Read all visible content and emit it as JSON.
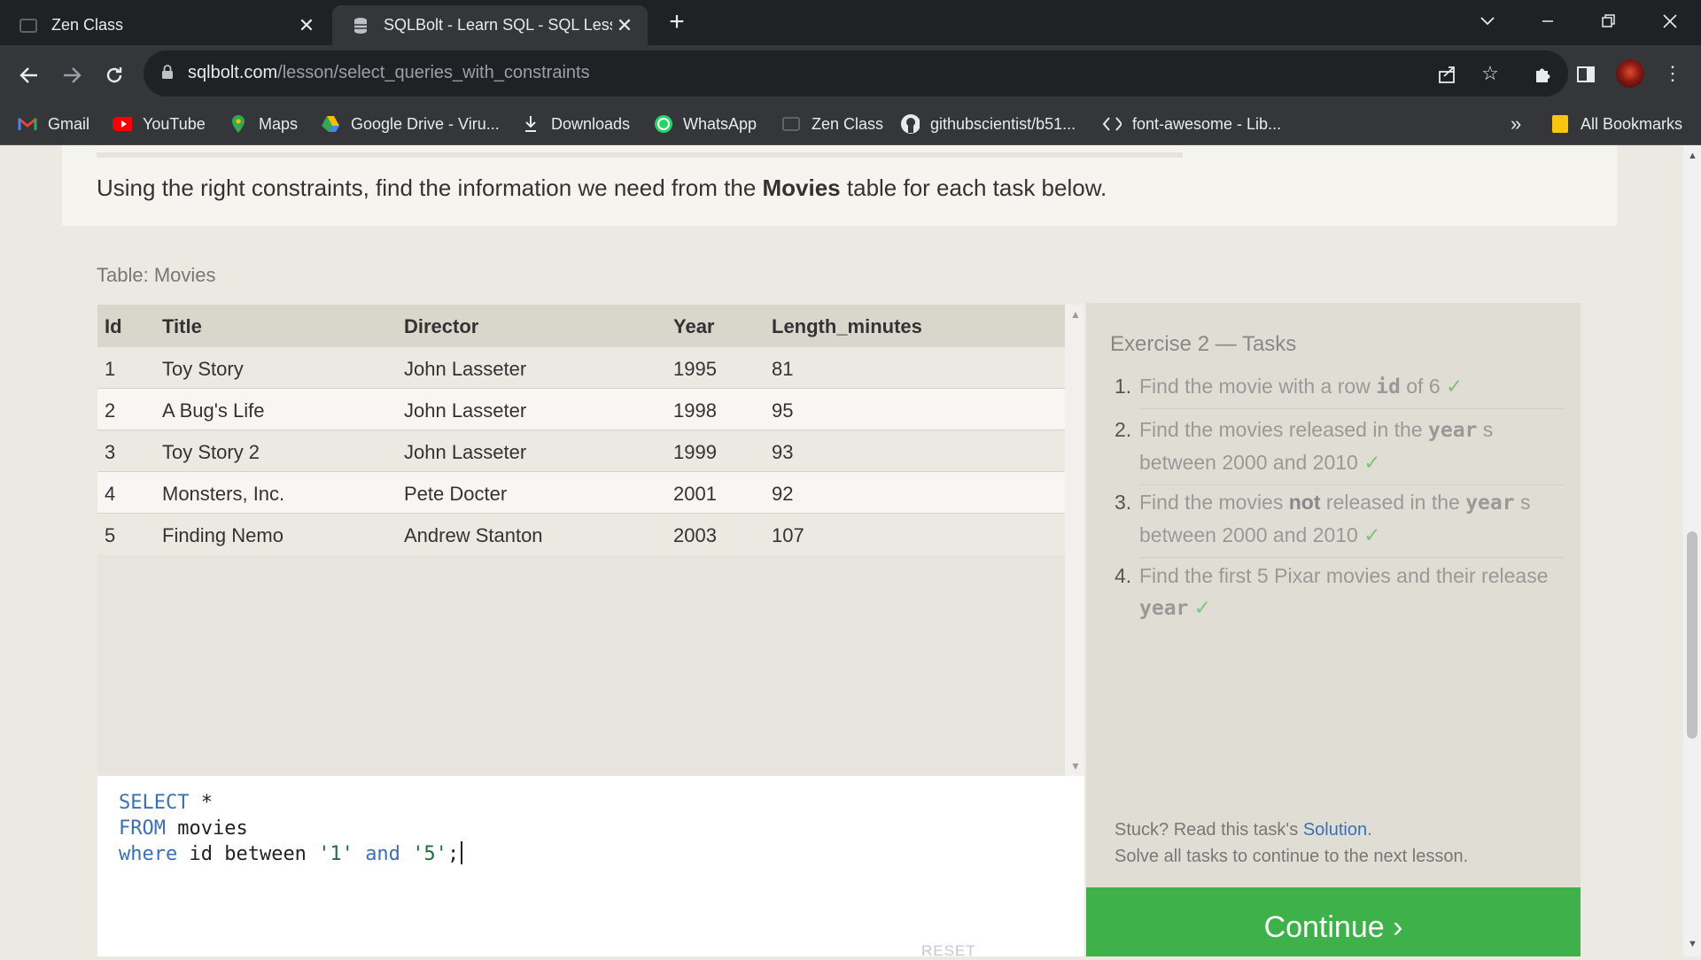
{
  "browser": {
    "tabs": [
      {
        "title": "Zen Class",
        "active": false
      },
      {
        "title": "SQLBolt - Learn SQL - SQL Lesso",
        "active": true
      }
    ],
    "new_tab_glyph": "+",
    "close_glyph": "✕",
    "url_host": "sqlbolt.com",
    "url_path": "/lesson/select_queries_with_constraints",
    "bookmarks": [
      {
        "label": "Gmail",
        "icon": "gmail-icon"
      },
      {
        "label": "YouTube",
        "icon": "youtube-icon"
      },
      {
        "label": "Maps",
        "icon": "maps-icon"
      },
      {
        "label": "Google Drive - Viru...",
        "icon": "google-drive-icon"
      },
      {
        "label": "Downloads",
        "icon": "download-icon"
      },
      {
        "label": "WhatsApp",
        "icon": "whatsapp-icon"
      },
      {
        "label": "Zen Class",
        "icon": "zen-class-icon"
      },
      {
        "label": "githubscientist/b51...",
        "icon": "github-icon"
      },
      {
        "label": "font-awesome - Lib...",
        "icon": "code-icon"
      }
    ],
    "bookmarks_overflow": "»",
    "all_bookmarks": "All Bookmarks"
  },
  "lesson": {
    "intro_before": "Using the right constraints, find the information we need from the ",
    "intro_bold": "Movies",
    "intro_after": " table for each task below.",
    "table_label": "Table: Movies",
    "columns": [
      "Id",
      "Title",
      "Director",
      "Year",
      "Length_minutes"
    ],
    "rows": [
      [
        "1",
        "Toy Story",
        "John Lasseter",
        "1995",
        "81"
      ],
      [
        "2",
        "A Bug's Life",
        "John Lasseter",
        "1998",
        "95"
      ],
      [
        "3",
        "Toy Story 2",
        "John Lasseter",
        "1999",
        "93"
      ],
      [
        "4",
        "Monsters, Inc.",
        "Pete Docter",
        "2001",
        "92"
      ],
      [
        "5",
        "Finding Nemo",
        "Andrew Stanton",
        "2003",
        "107"
      ]
    ],
    "code": {
      "line1_kw": "SELECT",
      "line1_rest": " *",
      "line2_kw": "FROM",
      "line2_rest": " movies",
      "line3_kw": "where",
      "line3_a": " id between ",
      "line3_s1": "'1'",
      "line3_and": "and",
      "line3_s2": "'5'",
      "line3_end": ";"
    },
    "reset_label": "RESET"
  },
  "tasks": {
    "title": "Exercise 2 — Tasks",
    "items": [
      {
        "num": "1.",
        "a": "Find the movie with a row ",
        "mono": "id",
        "b": " of 6 ",
        "check": "✓"
      },
      {
        "num": "2.",
        "a": "Find the movies released in the ",
        "mono": "year",
        "b": " s between 2000 and 2010 ",
        "check": "✓"
      },
      {
        "num": "3.",
        "a": "Find the movies ",
        "bold": "not",
        "a2": " released in the ",
        "mono": "year",
        "b": " s between 2000 and 2010 ",
        "check": "✓"
      },
      {
        "num": "4.",
        "a": "Find the first 5 Pixar movies and their release ",
        "mono": "year",
        "b": " ",
        "check": "✓"
      }
    ],
    "stuck_prefix": "Stuck? Read this task's ",
    "solution_link": "Solution",
    "stuck_suffix": ".",
    "solve_note": "Solve all tasks to continue to the next lesson.",
    "continue_label": "Continue ›"
  }
}
